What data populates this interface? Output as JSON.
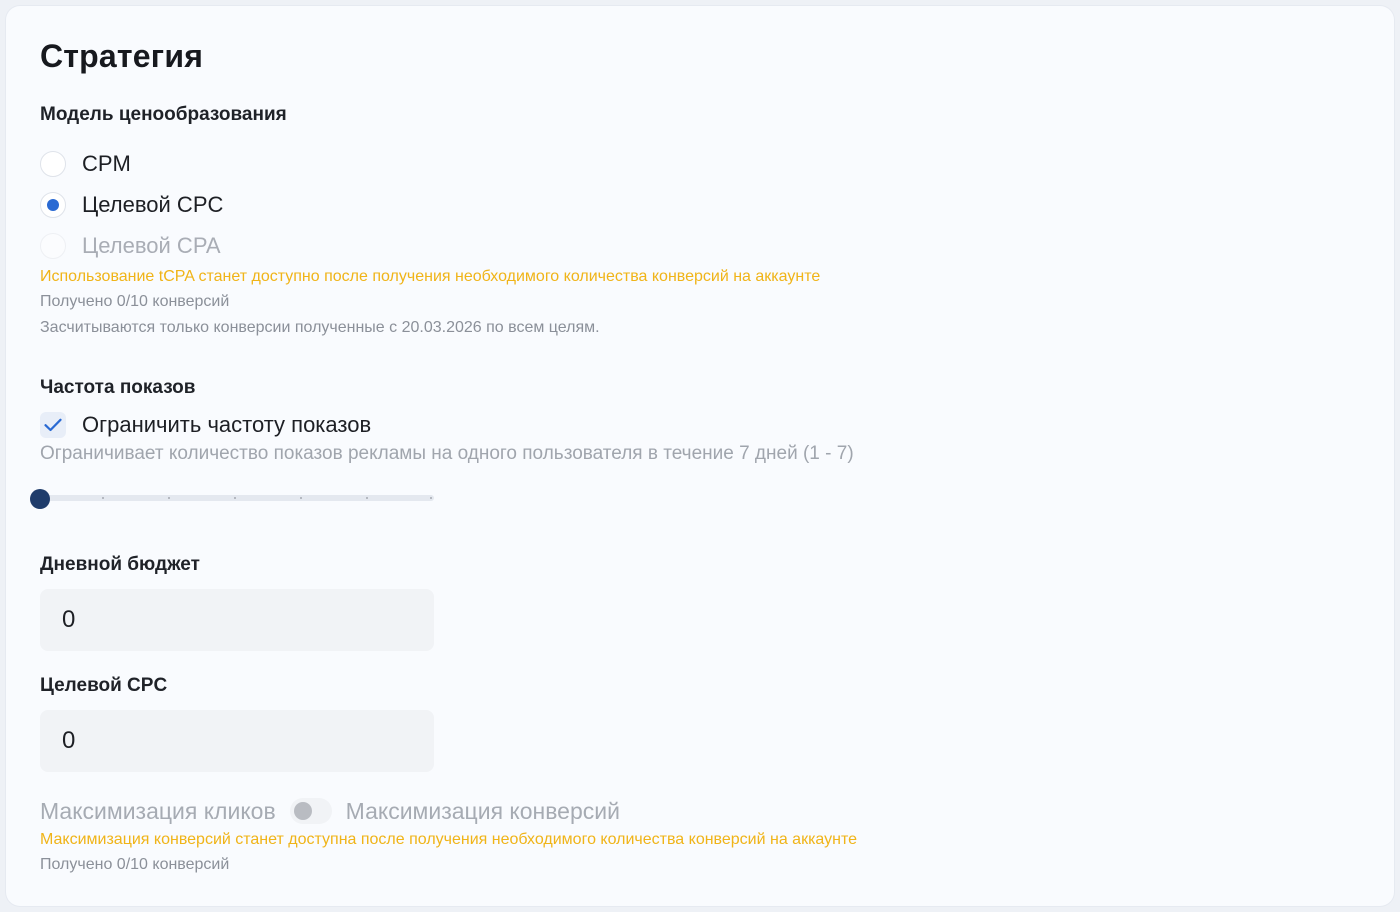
{
  "strategy": {
    "title": "Стратегия",
    "pricing": {
      "label": "Модель ценообразования",
      "options": [
        {
          "label": "CPM",
          "checked": false,
          "disabled": false
        },
        {
          "label": "Целевой CPC",
          "checked": true,
          "disabled": false
        },
        {
          "label": "Целевой CPA",
          "checked": false,
          "disabled": true
        }
      ],
      "warning": "Использование tCPA станет доступно после получения необходимого количества конверсий на аккаунте",
      "received": "Получено 0/10 конверсий",
      "note": "Засчитываются только конверсии полученные с 20.03.2026 по всем целям."
    },
    "frequency": {
      "label": "Частота показов",
      "checkbox_label": "Ограничить частоту показов",
      "checked": true,
      "hint": "Ограничивает количество показов рекламы на одного пользователя в течение 7 дней (1 - 7)",
      "slider_value": 1,
      "slider_min": 1,
      "slider_max": 7
    },
    "daily_budget": {
      "label": "Дневной бюджет",
      "value": "0"
    },
    "target_cpc": {
      "label": "Целевой CPC",
      "value": "0"
    },
    "optimization": {
      "left_label": "Максимизация кликов",
      "right_label": "Максимизация конверсий",
      "toggle_on": false,
      "warning": "Максимизация конверсий станет доступна после получения необходимого количества конверсий на аккаунте",
      "received": "Получено 0/10 конверсий"
    }
  },
  "colors": {
    "accent": "#2a6ad3",
    "warning": "#f0b418",
    "slider_thumb": "#1f3c6b"
  }
}
